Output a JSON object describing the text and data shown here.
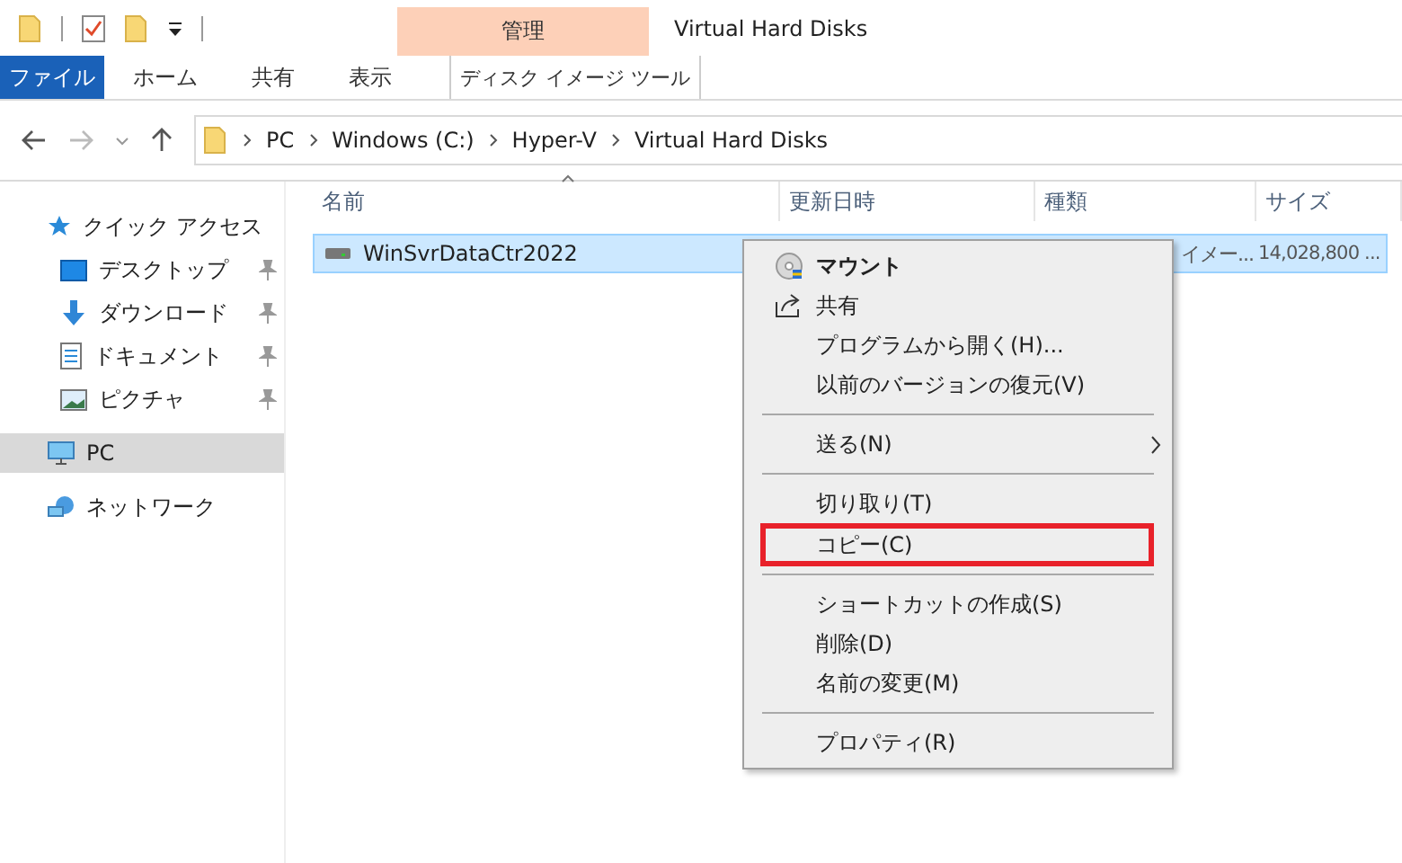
{
  "window": {
    "title": "Virtual Hard Disks"
  },
  "ribbon": {
    "contextual_group": "管理",
    "tabs": [
      {
        "label": "ファイル",
        "kind": "file"
      },
      {
        "label": "ホーム",
        "kind": "normal"
      },
      {
        "label": "共有",
        "kind": "normal"
      },
      {
        "label": "表示",
        "kind": "normal"
      },
      {
        "label": "ディスク イメージ ツール",
        "kind": "contextual"
      }
    ]
  },
  "address_bar": {
    "breadcrumbs": [
      "PC",
      "Windows (C:)",
      "Hyper-V",
      "Virtual Hard Disks"
    ]
  },
  "sidebar": {
    "items": [
      {
        "label": "クイック アクセス",
        "kind": "star",
        "selected": false,
        "children": [
          {
            "label": "デスクトップ",
            "kind": "desktop",
            "pinned": true
          },
          {
            "label": "ダウンロード",
            "kind": "download",
            "pinned": true
          },
          {
            "label": "ドキュメント",
            "kind": "document",
            "pinned": true
          },
          {
            "label": "ピクチャ",
            "kind": "picture",
            "pinned": true
          }
        ]
      },
      {
        "label": "PC",
        "kind": "pc",
        "selected": true
      },
      {
        "label": "ネットワーク",
        "kind": "network",
        "selected": false
      }
    ]
  },
  "table": {
    "columns": [
      "名前",
      "更新日時",
      "種類",
      "サイズ"
    ],
    "rows": [
      {
        "name": "WinSvrDataCtr2022",
        "type": "イメー...",
        "size": "14,028,800 ...",
        "selected": true
      }
    ]
  },
  "context_menu": {
    "items": [
      {
        "kind": "disc",
        "label": "マウント",
        "bold": true
      },
      {
        "kind": "share",
        "label": "共有"
      },
      {
        "kind": "item",
        "label": "プログラムから開く(H)..."
      },
      {
        "kind": "item",
        "label": "以前のバージョンの復元(V)"
      },
      {
        "kind": "separator"
      },
      {
        "kind": "item",
        "label": "送る(N)",
        "submenu": true
      },
      {
        "kind": "separator"
      },
      {
        "kind": "item",
        "label": "切り取り(T)"
      },
      {
        "kind": "item",
        "label": "コピー(C)",
        "emphasized": true
      },
      {
        "kind": "separator"
      },
      {
        "kind": "item",
        "label": "ショートカットの作成(S)"
      },
      {
        "kind": "item",
        "label": "削除(D)"
      },
      {
        "kind": "item",
        "label": "名前の変更(M)"
      },
      {
        "kind": "separator"
      },
      {
        "kind": "item",
        "label": "プロパティ(R)"
      }
    ]
  }
}
